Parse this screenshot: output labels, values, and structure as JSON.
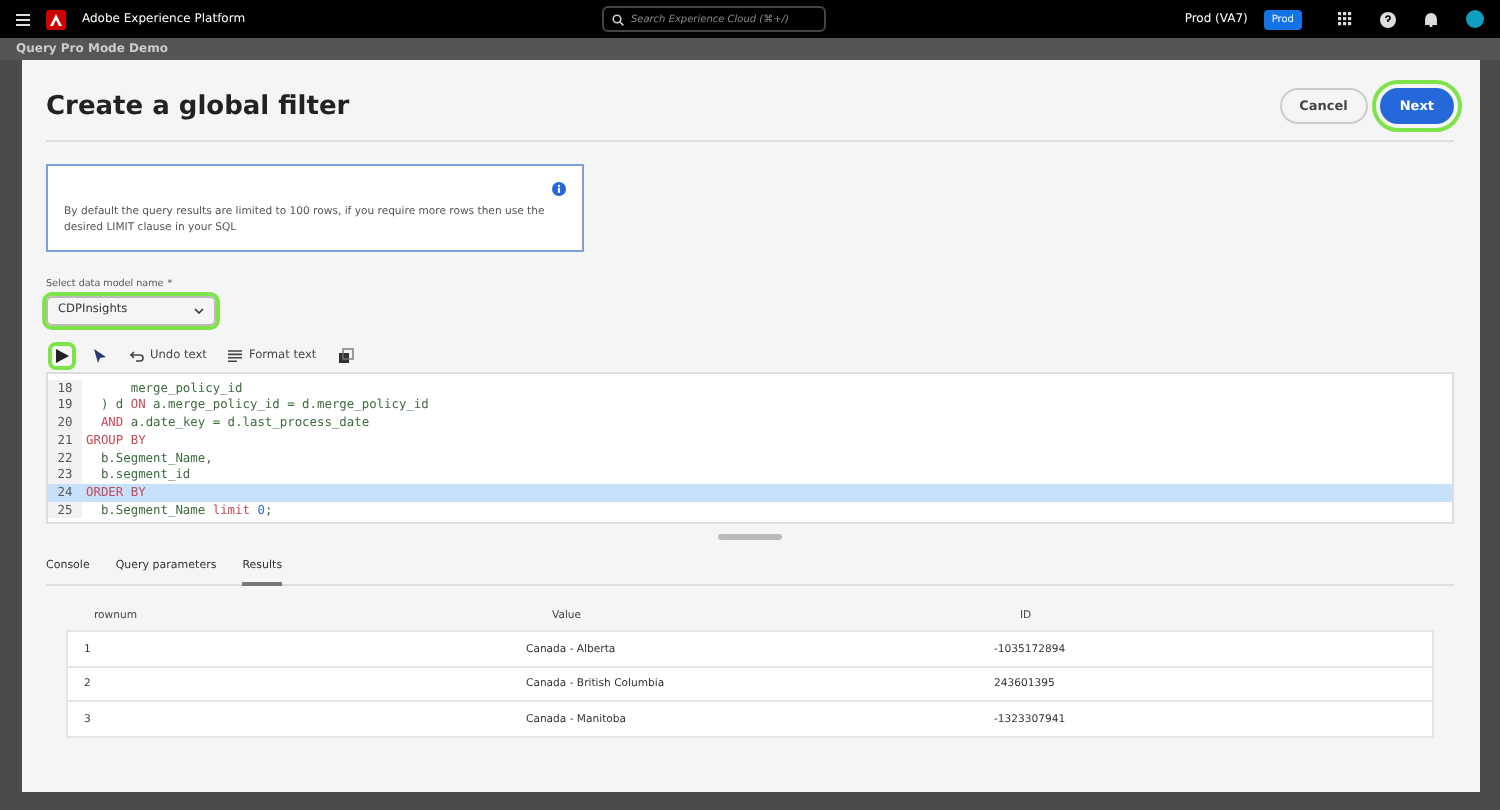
{
  "topbar": {
    "app_name": "Adobe Experience Platform",
    "search_placeholder": "Search Experience Cloud (⌘+/)",
    "sandbox": "Prod (VA7)",
    "sandbox_badge": "Prod"
  },
  "page": {
    "title": "Query Pro Mode Demo"
  },
  "dialog": {
    "title": "Create a global filter",
    "buttons": [
      {
        "label": "Cancel",
        "kind": "secondary",
        "highlighted": false
      },
      {
        "label": "Next",
        "kind": "primary",
        "highlighted": true
      }
    ],
    "notice": "By default the query results are limited to 100 rows, if you require more rows then use the desired LIMIT clause in your SQL",
    "model_select": {
      "label": "Select data model name",
      "required_mark": "*",
      "value": "CDPInsights",
      "highlighted": true
    },
    "toolbar": [
      {
        "kind": "run",
        "highlighted": true
      },
      {
        "kind": "run-selection",
        "highlighted": false
      },
      {
        "kind": "undo",
        "label": "Undo text",
        "highlighted": false
      },
      {
        "kind": "format",
        "label": "Format text",
        "highlighted": false
      },
      {
        "kind": "copy",
        "highlighted": false
      }
    ],
    "code_lines": [
      {
        "number": "18",
        "selected": false,
        "tokens": [
          {
            "kind": "plain",
            "text": "      merge_policy_id"
          }
        ]
      },
      {
        "number": "19",
        "selected": false,
        "tokens": [
          {
            "kind": "plain",
            "text": "  ) d "
          },
          {
            "kind": "keyword",
            "text": "ON"
          },
          {
            "kind": "plain",
            "text": " a.merge_policy_id = d.merge_policy_id"
          }
        ]
      },
      {
        "number": "20",
        "selected": false,
        "tokens": [
          {
            "kind": "keyword",
            "text": "  AND"
          },
          {
            "kind": "plain",
            "text": " a.date_key = d.last_process_date"
          }
        ]
      },
      {
        "number": "21",
        "selected": false,
        "tokens": [
          {
            "kind": "keyword",
            "text": "GROUP BY"
          }
        ]
      },
      {
        "number": "22",
        "selected": false,
        "tokens": [
          {
            "kind": "plain",
            "text": "  b.Segment_Name,"
          }
        ]
      },
      {
        "number": "23",
        "selected": false,
        "tokens": [
          {
            "kind": "plain",
            "text": "  b.segment_id"
          }
        ]
      },
      {
        "number": "24",
        "selected": true,
        "tokens": [
          {
            "kind": "keyword",
            "text": "ORDER BY"
          }
        ]
      },
      {
        "number": "25",
        "selected": false,
        "tokens": [
          {
            "kind": "plain",
            "text": "  b.Segment_Name "
          },
          {
            "kind": "keyword",
            "text": "limit "
          },
          {
            "kind": "number",
            "text": "0"
          },
          {
            "kind": "plain",
            "text": ";"
          }
        ]
      }
    ],
    "tabs": [
      {
        "label": "Console",
        "selected": false
      },
      {
        "label": "Query parameters",
        "selected": false
      },
      {
        "label": "Results",
        "selected": true
      }
    ],
    "table": {
      "columns": [
        "rownum",
        "Value",
        "ID"
      ],
      "rows": [
        [
          "1",
          "Canada - Alberta",
          "-1035172894"
        ],
        [
          "2",
          "Canada - British Columbia",
          "243601395"
        ],
        [
          "3",
          "Canada - Manitoba",
          "-1323307941"
        ]
      ]
    }
  }
}
